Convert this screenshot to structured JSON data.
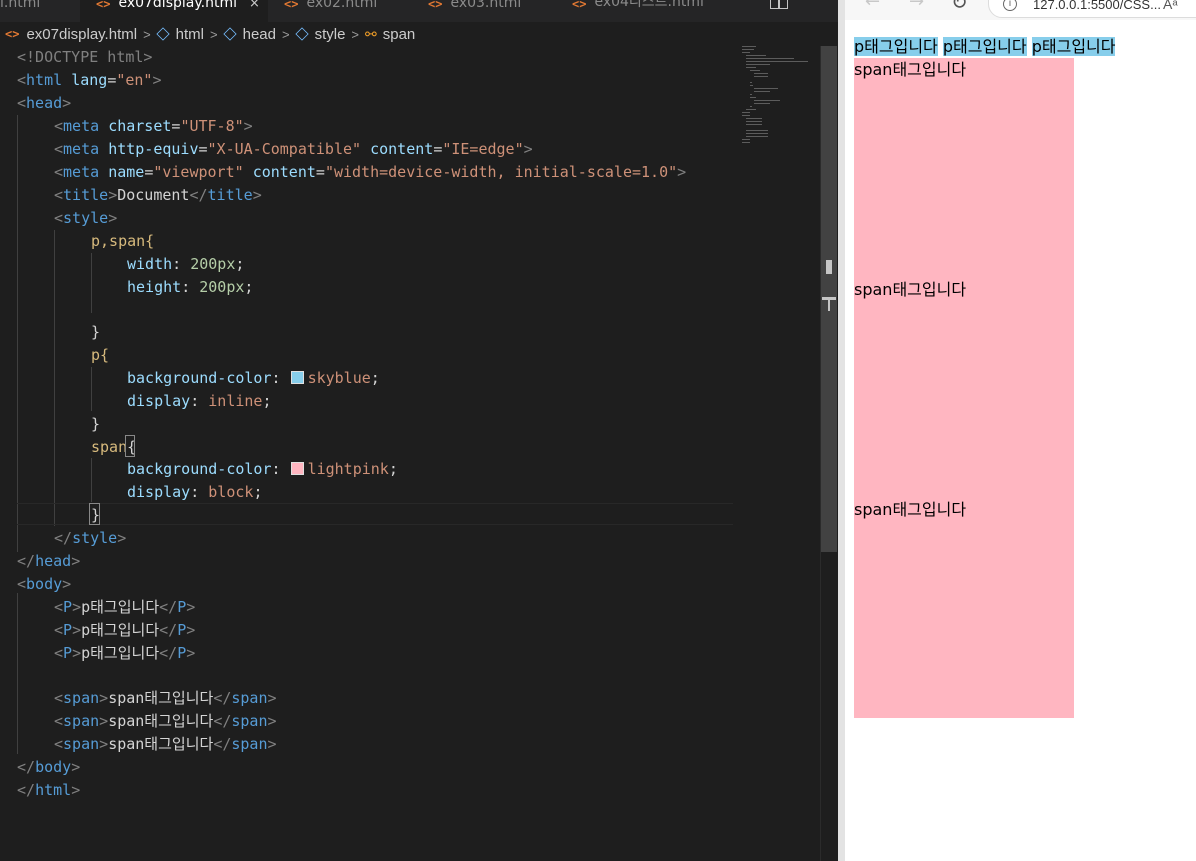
{
  "editor": {
    "tabs": [
      {
        "label": "l.html",
        "active": false
      },
      {
        "label": "ex07display.html",
        "active": true
      },
      {
        "label": "ex02.html",
        "active": false
      },
      {
        "label": "ex03.html",
        "active": false
      },
      {
        "label": "ex04리스트.html",
        "active": false
      }
    ],
    "tab_close_glyph": "×",
    "breadcrumb": {
      "file": "ex07display.html",
      "items": [
        "html",
        "head",
        "style",
        "span"
      ]
    },
    "code": {
      "doctype": "<!DOCTYPE html>",
      "lang": "\"en\"",
      "charset": "\"UTF-8\"",
      "http_equiv": "\"X-UA-Compatible\"",
      "compat_content": "\"IE=edge\"",
      "viewport_name": "\"viewport\"",
      "viewport_content": "\"width=device-width, initial-scale=1.0\"",
      "title_text": "Document",
      "selector_ps": "p,span{",
      "selector_p": "p{",
      "selector_span": "span",
      "width_prop": "width",
      "height_prop": "height",
      "size_value": "200px",
      "bg_prop": "background-color",
      "display_prop": "display",
      "skyblue": "skyblue",
      "inline": "inline",
      "lightpink": "lightpink",
      "block": "block",
      "p_text": "p태그입니다",
      "span_text": "span태그입니다"
    },
    "colors": {
      "skyblue": "#87ceeb",
      "lightpink": "#ffb6c1"
    }
  },
  "browser": {
    "url": "127.0.0.1:5500/CSS...",
    "aa": "Aᵃ",
    "p_items": [
      "p태그입니다",
      "p태그입니다",
      "p태그입니다"
    ],
    "span_items": [
      "span태그입니다",
      "span태그입니다",
      "span태그입니다"
    ]
  }
}
